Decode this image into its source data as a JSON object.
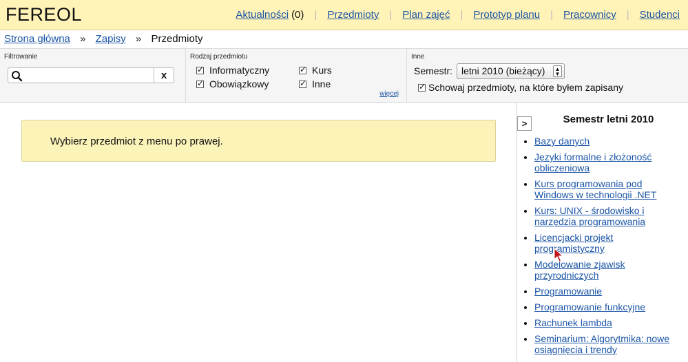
{
  "header": {
    "logo": "FEREOL",
    "nav": [
      {
        "label": "Aktualności",
        "count": "(0)"
      },
      {
        "label": "Przedmioty"
      },
      {
        "label": "Plan zajęć"
      },
      {
        "label": "Prototyp planu"
      },
      {
        "label": "Pracownicy"
      },
      {
        "label": "Studenci"
      }
    ]
  },
  "breadcrumb": {
    "items": [
      "Strona główna",
      "Zapisy",
      "Przedmioty"
    ],
    "separator": "»"
  },
  "filters": {
    "filter_heading": "Filtrowanie",
    "search_value": "",
    "clear_label": "x",
    "type_heading": "Rodzaj przedmiotu",
    "types": [
      {
        "label": "Informatyczny",
        "checked": true
      },
      {
        "label": "Kurs",
        "checked": true
      },
      {
        "label": "Obowiązkowy",
        "checked": true
      },
      {
        "label": "Inne",
        "checked": true
      }
    ],
    "more_label": "więcej",
    "other_heading": "Inne",
    "semester_label": "Semestr:",
    "semester_value": "letni 2010 (bieżący)",
    "hide_enrolled_label": "Schowaj przedmioty, na które byłem zapisany",
    "hide_enrolled_checked": true
  },
  "main": {
    "notice": "Wybierz przedmiot z menu po prawej."
  },
  "sidebar": {
    "toggle_label": ">",
    "title": "Semestr letni 2010",
    "courses": [
      "Bazy danych",
      "Języki formalne i złożoność obliczeniowa",
      "Kurs programowania pod Windows w technologii .NET",
      "Kurs: UNIX - środowisko i narzędzia programowania",
      "Licencjacki projekt programistyczny",
      "Modelowanie zjawisk przyrodniczych",
      "Programowanie",
      "Programowanie funkcyjne",
      "Rachunek lambda",
      "Seminarium: Algorytmika: nowe osiągnięcia i trendy"
    ]
  },
  "icons": {
    "search": "search-icon",
    "cursor": "mouse-cursor-icon"
  },
  "colors": {
    "header_bg": "#fff3b8",
    "notice_bg": "#fcf3b8",
    "link": "#1b55a6",
    "cursor": "#c0141b"
  }
}
